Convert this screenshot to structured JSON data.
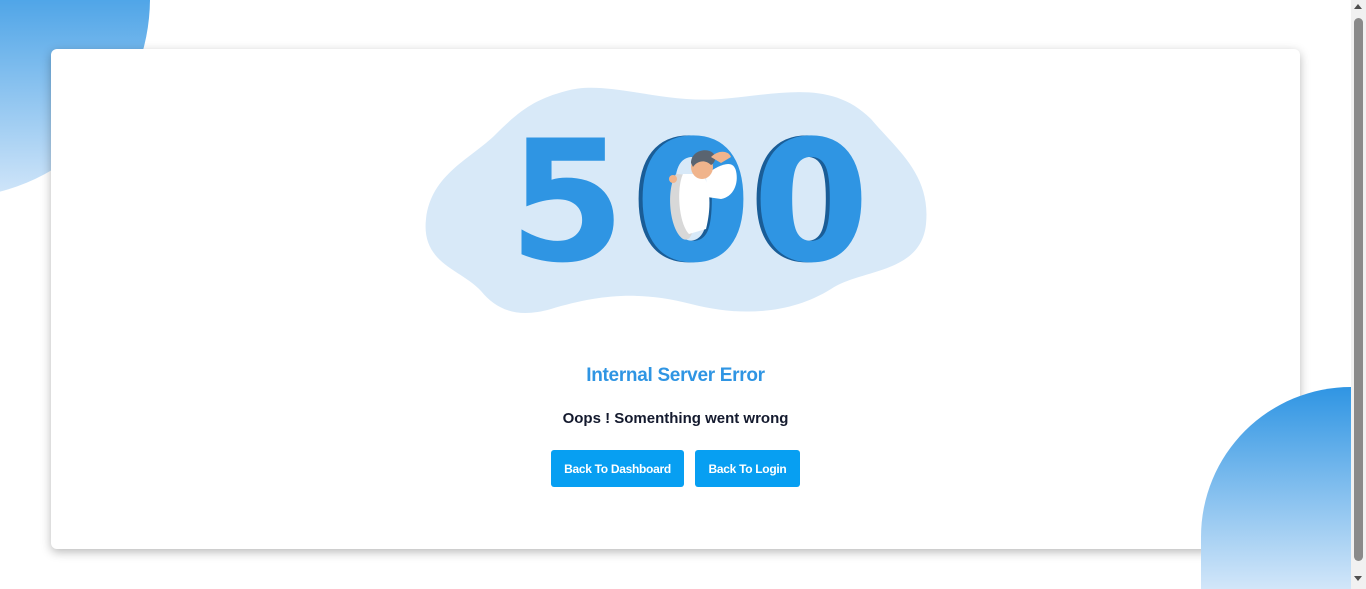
{
  "error": {
    "code_digits": [
      "5",
      "0",
      "0"
    ],
    "title": "Internal Server Error",
    "message": "Oops ! Somenthing went wrong"
  },
  "actions": {
    "dashboard_label": "Back To Dashboard",
    "login_label": "Back To Login"
  },
  "colors": {
    "accent": "#2f95e3",
    "button": "#079ff2",
    "blob_light": "#d8e9f8",
    "text_dark": "#141a2e"
  },
  "icons": [
    "person-peeking-illustration",
    "scroll-up-arrow-icon",
    "scroll-down-arrow-icon"
  ]
}
